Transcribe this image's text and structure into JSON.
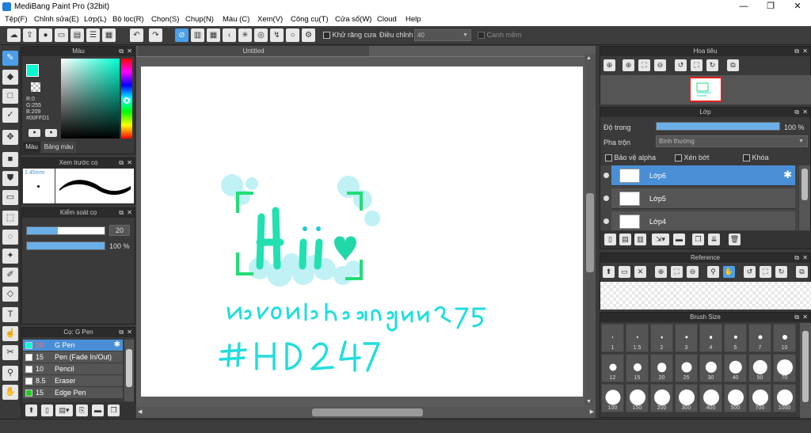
{
  "window": {
    "title": "MediBang Paint Pro (32bit)",
    "minimize": "—",
    "maximize": "❐",
    "close": "✕"
  },
  "menu": [
    "Tệp(F)",
    "Chỉnh sửa(E)",
    "Lớp(L)",
    "Bộ lọc(R)",
    "Chọn(S)",
    "Chụp(N)",
    "Màu (C)",
    "Xem(V)",
    "Công cụ(T)",
    "Cửa sổ(W)",
    "Cloud",
    "Help"
  ],
  "toolbar": {
    "antialias_label": "Khử răng cưa",
    "adjust_label": "Điều chỉnh",
    "adjust_value": "40",
    "edge_label": "Canh mềm"
  },
  "color_panel": {
    "title": "Màu",
    "r": "R:0",
    "g": "G:255",
    "b": "B:209",
    "hex": "#00FFD1",
    "tab_color": "Màu",
    "tab_palette": "Bảng màu",
    "fg_color": "#00ffd1",
    "bg_color": "#ffffff"
  },
  "preview_panel": {
    "title": "Xem trước cọ",
    "size": "1.45mm"
  },
  "control_panel": {
    "title": "Kiểm soát cọ",
    "size_value": "20",
    "size_fraction": 0.4,
    "opacity_value": "100 %",
    "opacity_fraction": 1.0
  },
  "brush_panel": {
    "title": "Cọ: G Pen",
    "brushes": [
      {
        "size": "20",
        "name": "G Pen",
        "color": "#00ffd1",
        "selected": true
      },
      {
        "size": "15",
        "name": "Pen (Fade In/Out)",
        "color": "#ffffff",
        "selected": false
      },
      {
        "size": "10",
        "name": "Pencil",
        "color": "#ffffff",
        "selected": false
      },
      {
        "size": "8.5",
        "name": "Eraser",
        "color": "#ffffff",
        "selected": false
      },
      {
        "size": "15",
        "name": "Edge Pen",
        "color": "#22cc22",
        "selected": false
      }
    ]
  },
  "document": {
    "tab": "Untitled",
    "drawing_text_1": "Hi",
    "drawing_text_2": "Nguyenlehoanguu975",
    "drawing_text_3": "#HD247"
  },
  "navigator": {
    "title": "Hoa tiêu"
  },
  "layer_panel": {
    "title": "Lớp",
    "opacity_label": "Độ trong",
    "opacity_value": "100 %",
    "opacity_fraction": 1.0,
    "blend_label": "Pha trộn",
    "blend_value": "Bình thường",
    "protect_alpha": "Bảo vệ alpha",
    "clipping": "Xén bớt",
    "lock": "Khóa",
    "layers": [
      {
        "name": "Lớp6",
        "selected": true
      },
      {
        "name": "Lớp5",
        "selected": false
      },
      {
        "name": "Lớp4",
        "selected": false
      }
    ]
  },
  "reference_panel": {
    "title": "Reference"
  },
  "brush_size_panel": {
    "title": "Brush Size",
    "sizes": [
      "1",
      "1.5",
      "2",
      "3",
      "4",
      "5",
      "7",
      "10",
      "12",
      "15",
      "20",
      "25",
      "30",
      "40",
      "50",
      "70",
      "100",
      "150",
      "200",
      "300",
      "400",
      "500",
      "700",
      "1000"
    ]
  },
  "colors": {
    "accent": "#4a9fe8",
    "drawing_cyan": "#22e0d0",
    "drawing_green": "#22dd77"
  }
}
